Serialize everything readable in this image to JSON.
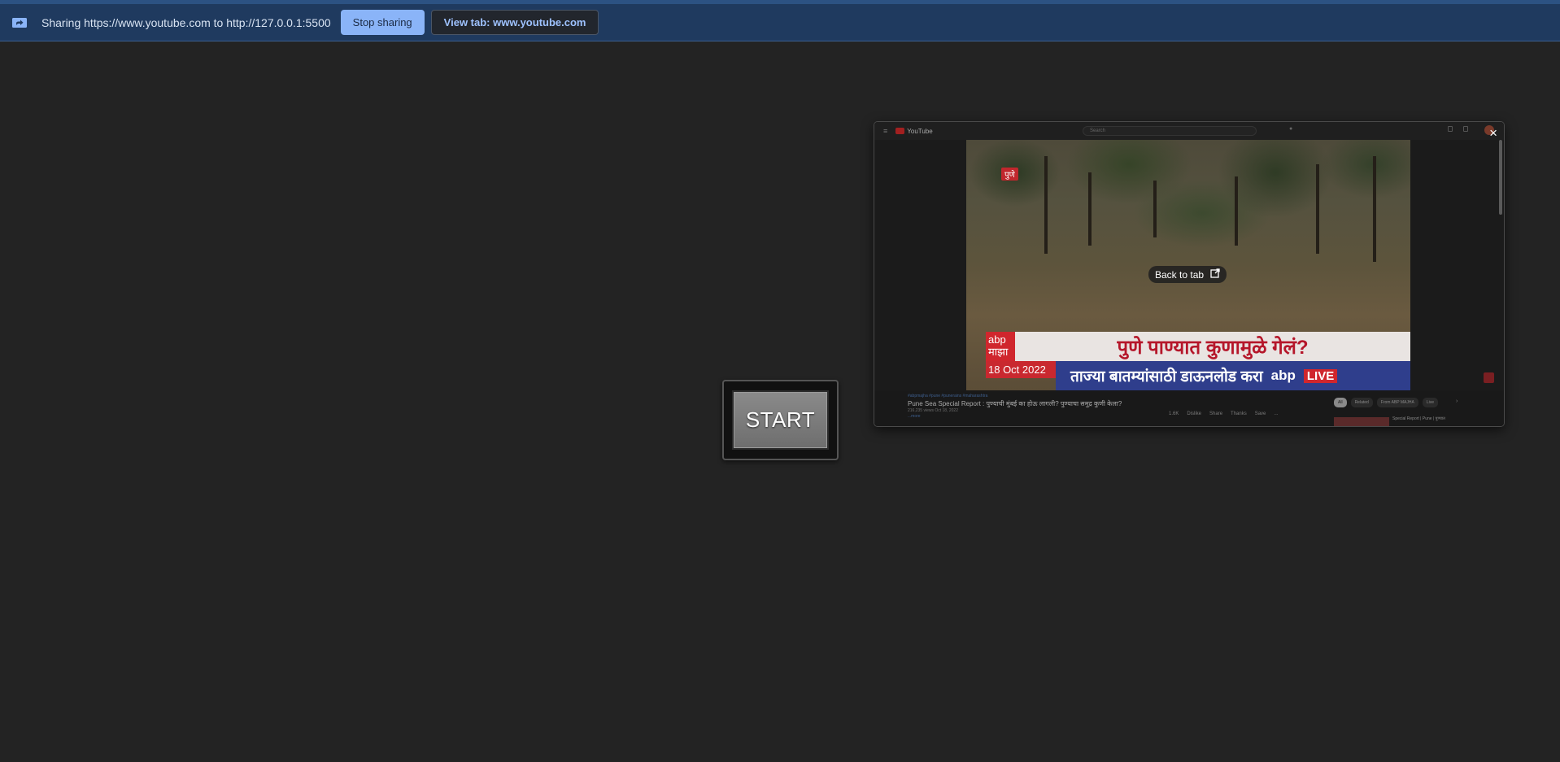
{
  "infobar": {
    "icon": "screen-share-icon",
    "sharing_text": "Sharing https://www.youtube.com to http://127.0.0.1:5500",
    "stop_label": "Stop sharing",
    "view_label": "View tab: www.youtube.com",
    "colors": {
      "background": "#1f3a5f",
      "stop_button": "#8ab4f8",
      "link_text": "#9ec2ff"
    }
  },
  "start_button": {
    "label": "START"
  },
  "preview": {
    "close_label": "×",
    "youtube": {
      "logo_text": "YouTube",
      "search_placeholder": "Search"
    },
    "video": {
      "location_tag": "पुणे",
      "back_to_tab_label": "Back to tab",
      "logo_line1": "abp",
      "logo_line2": "माझा",
      "headline": "पुणे पाण्यात कुणामुळे गेलं?",
      "date": "18 Oct 2022",
      "subline": "ताज्या बातम्यांसाठी डाऊनलोड करा",
      "brand": "abp",
      "live": "LIVE"
    },
    "info": {
      "channel_line": "#abpmajha #pune #punerains #maharashtra",
      "title": "Pune Sea Special Report : पुण्याची मुंबई का होऊ लागली? पुण्याचा समुद्र कुणी केला?",
      "meta": "216,235 views  Oct 18, 2022",
      "description": "...more",
      "actions": [
        "1.6K",
        "Dislike",
        "Share",
        "Thanks",
        "Save",
        "..."
      ],
      "chips": [
        "All",
        "Related",
        "From ABP MAJHA",
        "Live"
      ],
      "rec_title": "Special Report | Pune | पुण्यात"
    }
  }
}
